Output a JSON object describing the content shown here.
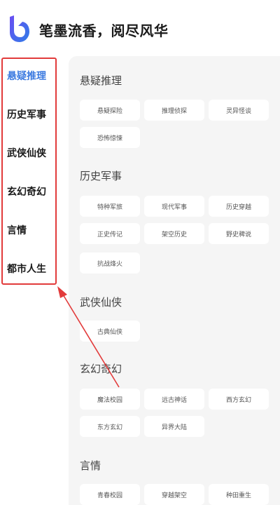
{
  "header": {
    "title": "笔墨流香，阅尽风华",
    "logo_icon": "book-b-logo-icon"
  },
  "colors": {
    "accent": "#3d7be0",
    "annotation": "#e23b3b",
    "background": "#f5f5f5"
  },
  "sidebar": {
    "items": [
      {
        "label": "悬疑推理",
        "active": true
      },
      {
        "label": "历史军事",
        "active": false
      },
      {
        "label": "武侠仙侠",
        "active": false
      },
      {
        "label": "玄幻奇幻",
        "active": false
      },
      {
        "label": "言情",
        "active": false
      },
      {
        "label": "都市人生",
        "active": false
      }
    ]
  },
  "sections": [
    {
      "title": "悬疑推理",
      "tags": [
        "悬疑探险",
        "推理侦探",
        "灵异怪谈",
        "恐怖惊悚"
      ]
    },
    {
      "title": "历史军事",
      "tags": [
        "特种军旅",
        "现代军事",
        "历史穿越",
        "正史传记",
        "架空历史",
        "野史稗说",
        "抗战烽火"
      ]
    },
    {
      "title": "武侠仙侠",
      "tags": [
        "古典仙侠"
      ]
    },
    {
      "title": "玄幻奇幻",
      "tags": [
        "魔法校园",
        "远古神话",
        "西方玄幻",
        "东方玄幻",
        "异界大陆"
      ]
    },
    {
      "title": "言情",
      "tags": [
        "青春校园",
        "穿越架空",
        "种田重生"
      ]
    }
  ]
}
